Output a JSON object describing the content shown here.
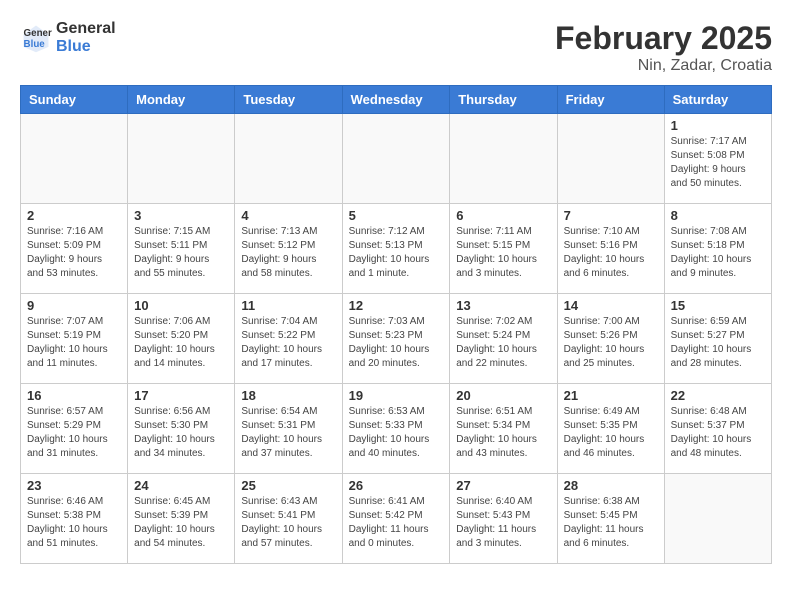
{
  "header": {
    "logo_general": "General",
    "logo_blue": "Blue",
    "title": "February 2025",
    "subtitle": "Nin, Zadar, Croatia"
  },
  "weekdays": [
    "Sunday",
    "Monday",
    "Tuesday",
    "Wednesday",
    "Thursday",
    "Friday",
    "Saturday"
  ],
  "weeks": [
    [
      {
        "day": "",
        "info": ""
      },
      {
        "day": "",
        "info": ""
      },
      {
        "day": "",
        "info": ""
      },
      {
        "day": "",
        "info": ""
      },
      {
        "day": "",
        "info": ""
      },
      {
        "day": "",
        "info": ""
      },
      {
        "day": "1",
        "info": "Sunrise: 7:17 AM\nSunset: 5:08 PM\nDaylight: 9 hours and 50 minutes."
      }
    ],
    [
      {
        "day": "2",
        "info": "Sunrise: 7:16 AM\nSunset: 5:09 PM\nDaylight: 9 hours and 53 minutes."
      },
      {
        "day": "3",
        "info": "Sunrise: 7:15 AM\nSunset: 5:11 PM\nDaylight: 9 hours and 55 minutes."
      },
      {
        "day": "4",
        "info": "Sunrise: 7:13 AM\nSunset: 5:12 PM\nDaylight: 9 hours and 58 minutes."
      },
      {
        "day": "5",
        "info": "Sunrise: 7:12 AM\nSunset: 5:13 PM\nDaylight: 10 hours and 1 minute."
      },
      {
        "day": "6",
        "info": "Sunrise: 7:11 AM\nSunset: 5:15 PM\nDaylight: 10 hours and 3 minutes."
      },
      {
        "day": "7",
        "info": "Sunrise: 7:10 AM\nSunset: 5:16 PM\nDaylight: 10 hours and 6 minutes."
      },
      {
        "day": "8",
        "info": "Sunrise: 7:08 AM\nSunset: 5:18 PM\nDaylight: 10 hours and 9 minutes."
      }
    ],
    [
      {
        "day": "9",
        "info": "Sunrise: 7:07 AM\nSunset: 5:19 PM\nDaylight: 10 hours and 11 minutes."
      },
      {
        "day": "10",
        "info": "Sunrise: 7:06 AM\nSunset: 5:20 PM\nDaylight: 10 hours and 14 minutes."
      },
      {
        "day": "11",
        "info": "Sunrise: 7:04 AM\nSunset: 5:22 PM\nDaylight: 10 hours and 17 minutes."
      },
      {
        "day": "12",
        "info": "Sunrise: 7:03 AM\nSunset: 5:23 PM\nDaylight: 10 hours and 20 minutes."
      },
      {
        "day": "13",
        "info": "Sunrise: 7:02 AM\nSunset: 5:24 PM\nDaylight: 10 hours and 22 minutes."
      },
      {
        "day": "14",
        "info": "Sunrise: 7:00 AM\nSunset: 5:26 PM\nDaylight: 10 hours and 25 minutes."
      },
      {
        "day": "15",
        "info": "Sunrise: 6:59 AM\nSunset: 5:27 PM\nDaylight: 10 hours and 28 minutes."
      }
    ],
    [
      {
        "day": "16",
        "info": "Sunrise: 6:57 AM\nSunset: 5:29 PM\nDaylight: 10 hours and 31 minutes."
      },
      {
        "day": "17",
        "info": "Sunrise: 6:56 AM\nSunset: 5:30 PM\nDaylight: 10 hours and 34 minutes."
      },
      {
        "day": "18",
        "info": "Sunrise: 6:54 AM\nSunset: 5:31 PM\nDaylight: 10 hours and 37 minutes."
      },
      {
        "day": "19",
        "info": "Sunrise: 6:53 AM\nSunset: 5:33 PM\nDaylight: 10 hours and 40 minutes."
      },
      {
        "day": "20",
        "info": "Sunrise: 6:51 AM\nSunset: 5:34 PM\nDaylight: 10 hours and 43 minutes."
      },
      {
        "day": "21",
        "info": "Sunrise: 6:49 AM\nSunset: 5:35 PM\nDaylight: 10 hours and 46 minutes."
      },
      {
        "day": "22",
        "info": "Sunrise: 6:48 AM\nSunset: 5:37 PM\nDaylight: 10 hours and 48 minutes."
      }
    ],
    [
      {
        "day": "23",
        "info": "Sunrise: 6:46 AM\nSunset: 5:38 PM\nDaylight: 10 hours and 51 minutes."
      },
      {
        "day": "24",
        "info": "Sunrise: 6:45 AM\nSunset: 5:39 PM\nDaylight: 10 hours and 54 minutes."
      },
      {
        "day": "25",
        "info": "Sunrise: 6:43 AM\nSunset: 5:41 PM\nDaylight: 10 hours and 57 minutes."
      },
      {
        "day": "26",
        "info": "Sunrise: 6:41 AM\nSunset: 5:42 PM\nDaylight: 11 hours and 0 minutes."
      },
      {
        "day": "27",
        "info": "Sunrise: 6:40 AM\nSunset: 5:43 PM\nDaylight: 11 hours and 3 minutes."
      },
      {
        "day": "28",
        "info": "Sunrise: 6:38 AM\nSunset: 5:45 PM\nDaylight: 11 hours and 6 minutes."
      },
      {
        "day": "",
        "info": ""
      }
    ]
  ]
}
